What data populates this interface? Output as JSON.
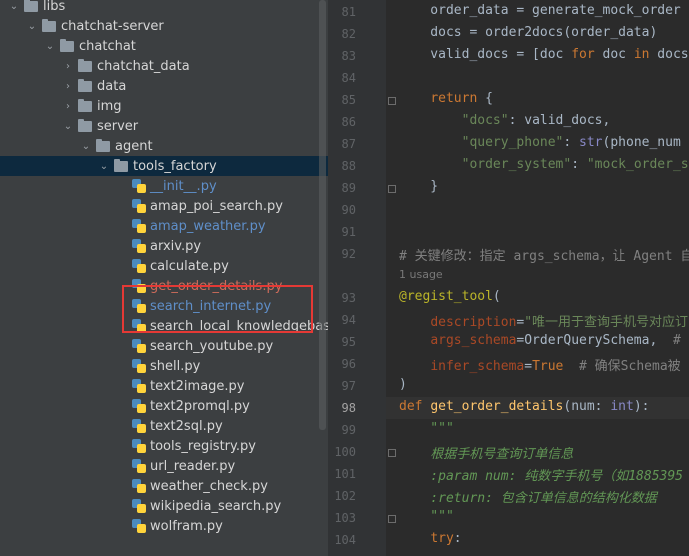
{
  "tree": [
    {
      "label": "libs",
      "type": "folder",
      "expanded": true,
      "indent": 0
    },
    {
      "label": "chatchat-server",
      "type": "folder",
      "expanded": true,
      "indent": 1
    },
    {
      "label": "chatchat",
      "type": "folder",
      "expanded": true,
      "indent": 2
    },
    {
      "label": "chatchat_data",
      "type": "folder",
      "expanded": false,
      "indent": 3
    },
    {
      "label": "data",
      "type": "folder",
      "expanded": false,
      "indent": 3
    },
    {
      "label": "img",
      "type": "folder",
      "expanded": false,
      "indent": 3
    },
    {
      "label": "server",
      "type": "folder",
      "expanded": true,
      "indent": 3
    },
    {
      "label": "agent",
      "type": "folder",
      "expanded": true,
      "indent": 4
    },
    {
      "label": "tools_factory",
      "type": "folder",
      "expanded": true,
      "indent": 5,
      "selected": true
    },
    {
      "label": "__init__.py",
      "type": "py",
      "color": "blue",
      "indent": 6
    },
    {
      "label": "amap_poi_search.py",
      "type": "py",
      "indent": 6
    },
    {
      "label": "amap_weather.py",
      "type": "py",
      "color": "blue",
      "indent": 6
    },
    {
      "label": "arxiv.py",
      "type": "py",
      "indent": 6
    },
    {
      "label": "calculate.py",
      "type": "py",
      "indent": 6
    },
    {
      "label": "get_order_details.py",
      "type": "py",
      "color": "red",
      "indent": 6
    },
    {
      "label": "search_internet.py",
      "type": "py",
      "color": "blue",
      "indent": 6
    },
    {
      "label": "search_local_knowledgebase.py",
      "type": "py",
      "indent": 6
    },
    {
      "label": "search_youtube.py",
      "type": "py",
      "indent": 6
    },
    {
      "label": "shell.py",
      "type": "py",
      "indent": 6
    },
    {
      "label": "text2image.py",
      "type": "py",
      "indent": 6
    },
    {
      "label": "text2promql.py",
      "type": "py",
      "indent": 6
    },
    {
      "label": "text2sql.py",
      "type": "py",
      "indent": 6
    },
    {
      "label": "tools_registry.py",
      "type": "py",
      "indent": 6
    },
    {
      "label": "url_reader.py",
      "type": "py",
      "indent": 6
    },
    {
      "label": "weather_check.py",
      "type": "py",
      "indent": 6
    },
    {
      "label": "wikipedia_search.py",
      "type": "py",
      "indent": 6
    },
    {
      "label": "wolfram.py",
      "type": "py",
      "indent": 6
    }
  ],
  "editor": {
    "line_numbers": [
      "81",
      "82",
      "83",
      "84",
      "85",
      "86",
      "87",
      "88",
      "89",
      "90",
      "91",
      "92",
      "",
      "93",
      "94",
      "95",
      "96",
      "97",
      "98",
      "99",
      "100",
      "101",
      "102",
      "103",
      "104"
    ],
    "current_line": "98",
    "lines": [
      [
        {
          "t": "    order_data = generate_mock_order",
          "c": ""
        }
      ],
      [
        {
          "t": "    docs = order2docs(order_data)",
          "c": ""
        }
      ],
      [
        {
          "t": "    valid_docs = [doc ",
          "c": ""
        },
        {
          "t": "for",
          "c": "kw"
        },
        {
          "t": " doc ",
          "c": ""
        },
        {
          "t": "in",
          "c": "kw"
        },
        {
          "t": " docs",
          "c": ""
        }
      ],
      [
        {
          "t": "",
          "c": ""
        }
      ],
      [
        {
          "t": "    ",
          "c": ""
        },
        {
          "t": "return",
          "c": "kw"
        },
        {
          "t": " {",
          "c": ""
        }
      ],
      [
        {
          "t": "        ",
          "c": ""
        },
        {
          "t": "\"docs\"",
          "c": "str"
        },
        {
          "t": ": valid_docs,",
          "c": ""
        }
      ],
      [
        {
          "t": "        ",
          "c": ""
        },
        {
          "t": "\"query_phone\"",
          "c": "str"
        },
        {
          "t": ": ",
          "c": ""
        },
        {
          "t": "str",
          "c": "builtin"
        },
        {
          "t": "(phone_num",
          "c": ""
        }
      ],
      [
        {
          "t": "        ",
          "c": ""
        },
        {
          "t": "\"order_system\"",
          "c": "str"
        },
        {
          "t": ": ",
          "c": ""
        },
        {
          "t": "\"mock_order_s",
          "c": "str"
        }
      ],
      [
        {
          "t": "    }",
          "c": ""
        }
      ],
      [
        {
          "t": "",
          "c": ""
        }
      ],
      [
        {
          "t": "",
          "c": ""
        }
      ],
      [
        {
          "t": "# 关键修改：指定 args_schema，让 Agent 自",
          "c": "cmt"
        }
      ],
      [
        {
          "t": "1 usage",
          "c": "usage"
        }
      ],
      [
        {
          "t": "@regist_tool",
          "c": "dec"
        },
        {
          "t": "(",
          "c": ""
        }
      ],
      [
        {
          "t": "    ",
          "c": ""
        },
        {
          "t": "description",
          "c": "param"
        },
        {
          "t": "=",
          "c": ""
        },
        {
          "t": "\"唯一用于查询手机号对应订",
          "c": "str"
        }
      ],
      [
        {
          "t": "    ",
          "c": ""
        },
        {
          "t": "args_schema",
          "c": "param"
        },
        {
          "t": "=OrderQuerySchema,  ",
          "c": ""
        },
        {
          "t": "#",
          "c": "cmt"
        }
      ],
      [
        {
          "t": "    ",
          "c": ""
        },
        {
          "t": "infer_schema",
          "c": "param"
        },
        {
          "t": "=",
          "c": ""
        },
        {
          "t": "True",
          "c": "kw"
        },
        {
          "t": "  ",
          "c": ""
        },
        {
          "t": "# 确保Schema被",
          "c": "cmt"
        }
      ],
      [
        {
          "t": ")",
          "c": ""
        }
      ],
      [
        {
          "t": "def",
          "c": "kw"
        },
        {
          "t": " ",
          "c": ""
        },
        {
          "t": "get_order_details",
          "c": "fn"
        },
        {
          "t": "(num: ",
          "c": ""
        },
        {
          "t": "int",
          "c": "builtin"
        },
        {
          "t": "):",
          "c": ""
        }
      ],
      [
        {
          "t": "    \"\"\"",
          "c": "doc"
        }
      ],
      [
        {
          "t": "    根据手机号查询订单信息",
          "c": "doc"
        }
      ],
      [
        {
          "t": "    :param num: 纯数字手机号（如1885395",
          "c": "doc"
        }
      ],
      [
        {
          "t": "    :return: 包含订单信息的结构化数据",
          "c": "doc"
        }
      ],
      [
        {
          "t": "    \"\"\"",
          "c": "doc"
        }
      ],
      [
        {
          "t": "    ",
          "c": ""
        },
        {
          "t": "try",
          "c": "kw"
        },
        {
          "t": ":",
          "c": ""
        }
      ]
    ]
  }
}
